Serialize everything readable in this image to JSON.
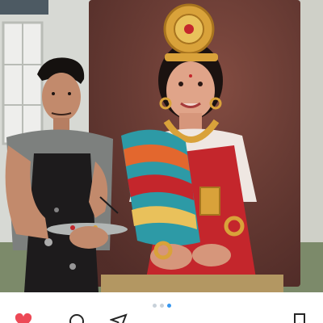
{
  "post": {
    "media_type": "photo",
    "subject": "painter-with-portrait-canvas",
    "carousel": {
      "total": 3,
      "active_index": 2
    }
  },
  "actions": {
    "icons": [
      "heart-icon",
      "comment-icon",
      "share-icon",
      "bookmark-icon"
    ]
  },
  "colors": {
    "canvas_bg": "#6e3b33",
    "dress_red": "#c4262c",
    "gold": "#d9a23a",
    "shawl_teal": "#2d9aa6",
    "apron": "#1d1b1c",
    "active_dot": "#3797f0",
    "like_red": "#ed4956"
  }
}
